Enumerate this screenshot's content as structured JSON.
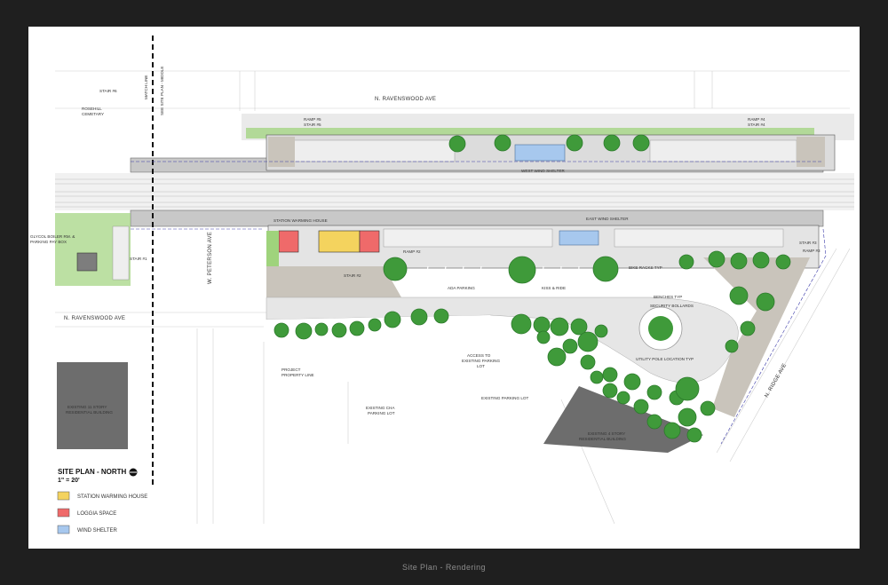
{
  "caption": "Site Plan - Rendering",
  "title": {
    "main": "SITE PLAN - NORTH",
    "scale": "1\" = 20'"
  },
  "streets": {
    "ravenswood_top": "N. RAVENSWOOD AVE",
    "ravenswood_bottom": "N. RAVENSWOOD AVE",
    "peterson": "W. PETERSON AVE",
    "ridge": "N. RIDGE AVE"
  },
  "labels": {
    "stair6": "STAIR #6",
    "match_line": "MATCH LINE",
    "see_site_plan": "SEE SITE PLAN - MIDDLE",
    "rosehill_1": "ROSEHILL",
    "rosehill_2": "CEMETARY",
    "ramp5": "RAMP #5",
    "stair5": "STAIR #5",
    "ramp4": "RAMP #4",
    "stair4": "STAIR #4",
    "west_wind_shelter": "WEST WIND SHELTER",
    "station_warming_house": "STATION WARMING HOUSE",
    "east_wind_shelter": "EAST WIND SHELTER",
    "glycol_1": "GLYCOL BOILER RM. &",
    "glycol_2": "PARKING PAY BOX",
    "stair1": "STAIR #1",
    "ramp2": "RAMP #2",
    "stair2": "STAIR #2",
    "ada_parking": "ADA PARKING",
    "kiss_ride": "KISS & RIDE",
    "bike_racks": "BIKE RACKS TYP",
    "stair3": "STAIR #3",
    "ramp3": "RAMP #3",
    "benches": "BENCHES TYP",
    "bollards": "SECURITY BOLLARDS",
    "utility_pole": "UTILITY POLE LOCATION TYP",
    "project_line_1": "PROJECT",
    "project_line_2": "PROPERTY LINE",
    "access_1": "ACCESS TO",
    "access_2": "EXISTING PARKING",
    "access_3": "LOT",
    "cha_1": "EXISTING CHA",
    "cha_2": "PARKING LOT",
    "existing_parking": "EXISTING PARKING LOT",
    "res11_1": "EXISTING 11 STORY",
    "res11_2": "RESIDENTIAL BUILDING",
    "res4_1": "EXISTING 4 STORY",
    "res4_2": "RESIDENTIAL BUILDING"
  },
  "legend": [
    {
      "label": "STATION WARMING HOUSE",
      "color": "#f4d35e"
    },
    {
      "label": "LOGGIA SPACE",
      "color": "#ef6a6a"
    },
    {
      "label": "WIND SHELTER",
      "color": "#a7c8ee"
    }
  ],
  "colors": {
    "tree": "#3f9a3a",
    "tree_dark": "#2c7a2b",
    "grass": "#9fd37c",
    "paver": "#c9c4bb",
    "building": "#6d6d6d",
    "platform": "#c8c8c8"
  }
}
